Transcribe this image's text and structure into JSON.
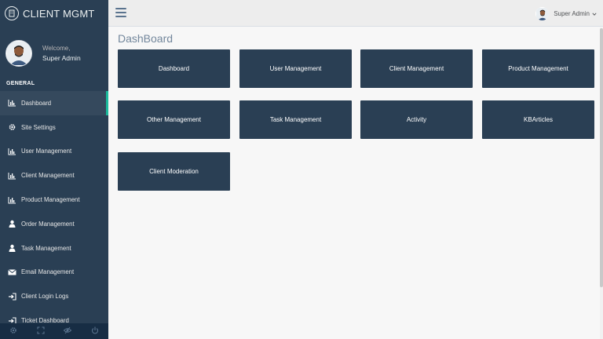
{
  "brand": {
    "title": "CLIENT MGMT"
  },
  "profile": {
    "welcome": "Welcome,",
    "name": "Super Admin"
  },
  "sidebar": {
    "section": "GENERAL",
    "items": [
      {
        "label": "Dashboard",
        "icon": "bar-chart-icon"
      },
      {
        "label": "Site Settings",
        "icon": "gear-icon"
      },
      {
        "label": "User Management",
        "icon": "bar-chart-icon"
      },
      {
        "label": "Client Management",
        "icon": "bar-chart-icon"
      },
      {
        "label": "Product Management",
        "icon": "bar-chart-icon"
      },
      {
        "label": "Order Management",
        "icon": "user-icon"
      },
      {
        "label": "Task Management",
        "icon": "user-icon"
      },
      {
        "label": "Email Management",
        "icon": "envelope-icon"
      },
      {
        "label": "Client Login Logs",
        "icon": "sign-in-icon"
      },
      {
        "label": "Ticket Dashboard",
        "icon": "sign-in-icon"
      }
    ],
    "footer": [
      "gear-icon",
      "fullscreen-icon",
      "eye-slash-icon",
      "power-icon"
    ]
  },
  "topnav": {
    "user": "Super Admin"
  },
  "main": {
    "title": "DashBoard",
    "tiles": [
      "Dashboard",
      "User Management",
      "Client Management",
      "Product Management",
      "Other Management",
      "Task Management",
      "Activity",
      "KBArticles",
      "Client Moderation"
    ]
  },
  "colors": {
    "sidebar": "#2a3f54",
    "accent": "#1abb9c",
    "tile": "#2a3f54"
  }
}
